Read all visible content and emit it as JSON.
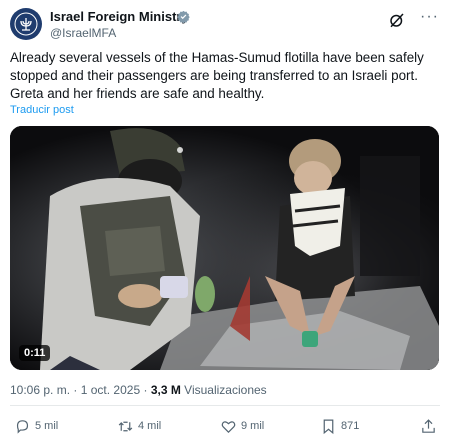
{
  "account": {
    "display_name": "Israel Foreign Ministry",
    "handle": "@IsraelMFA",
    "verified_icon": "verified-badge-icon",
    "avatar_icon": "menorah-emblem-icon",
    "colors": {
      "avatar_bg": "#1f3c6e",
      "verified": "#829aab"
    }
  },
  "header_actions": {
    "grok_icon": "grok-icon",
    "more_label": "···"
  },
  "post": {
    "text": "Already several vessels of the Hamas-Sumud flotilla have been safely stopped and their passengers are being transferred to an Israeli port. Greta and her friends are safe and healthy.",
    "translate_label": "Traducir post"
  },
  "video": {
    "duration": "0:11"
  },
  "meta": {
    "time": "10:06 p. m.",
    "separator": "·",
    "date": "1 oct. 2025",
    "separator2": "·",
    "views_count": "3,3 M",
    "views_label": "Visualizaciones"
  },
  "actions": {
    "replies": "5 mil",
    "reposts": "4 mil",
    "likes": "9 mil",
    "bookmarks": "871"
  },
  "colors": {
    "link": "#1d9bf0",
    "secondary_text": "#536471",
    "primary_text": "#0f1419"
  }
}
